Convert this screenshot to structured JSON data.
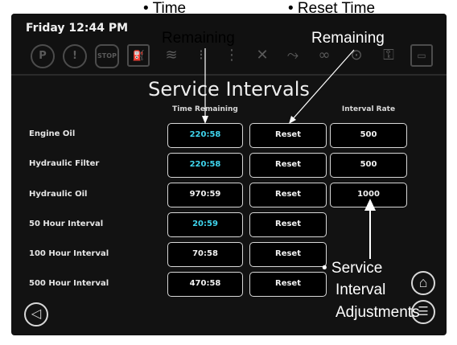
{
  "status_bar": {
    "clock": "Friday 12:44 PM",
    "icons": [
      {
        "name": "parking-brake-icon",
        "glyph": "P"
      },
      {
        "name": "warning-icon",
        "glyph": "!"
      },
      {
        "name": "stop-icon",
        "glyph": "STOP"
      },
      {
        "name": "fuel-filter-icon",
        "glyph": "⛽"
      },
      {
        "name": "coolant-temp-icon",
        "glyph": "≋"
      },
      {
        "name": "hydraulic-warning-icon",
        "glyph": "⁝"
      },
      {
        "name": "battery-icon",
        "glyph": "⋮"
      },
      {
        "name": "engine-fault-icon",
        "glyph": "✕"
      },
      {
        "name": "hydraulic-oil-icon",
        "glyph": "⤳"
      },
      {
        "name": "oil-pressure-icon",
        "glyph": "∞"
      },
      {
        "name": "engine-temp-icon",
        "glyph": "⊙"
      },
      {
        "name": "transmission-icon",
        "glyph": "⚿"
      },
      {
        "name": "display-icon",
        "glyph": "▭"
      }
    ]
  },
  "page": {
    "title": "Service Intervals",
    "columns": {
      "time_remaining": "Time Remaining",
      "interval_rate": "Interval Rate"
    },
    "rows": [
      {
        "label": "Engine Oil",
        "time_remaining": "220:58",
        "reset": "Reset",
        "interval_rate": "500",
        "highlight": true
      },
      {
        "label": "Hydraulic Filter",
        "time_remaining": "220:58",
        "reset": "Reset",
        "interval_rate": "500",
        "highlight": true
      },
      {
        "label": "Hydraulic Oil",
        "time_remaining": "970:59",
        "reset": "Reset",
        "interval_rate": "1000",
        "highlight": false
      },
      {
        "label": "50 Hour Interval",
        "time_remaining": "20:59",
        "reset": "Reset",
        "interval_rate": "",
        "highlight": true
      },
      {
        "label": "100 Hour Interval",
        "time_remaining": "70:58",
        "reset": "Reset",
        "interval_rate": "",
        "highlight": false
      },
      {
        "label": "500 Hour Interval",
        "time_remaining": "470:58",
        "reset": "Reset",
        "interval_rate": "",
        "highlight": false
      }
    ],
    "highlight_color": "#3fd5ee"
  },
  "nav": {
    "back_glyph": "◁",
    "home_glyph": "⌂",
    "menu_glyph": "☰"
  },
  "annotations": {
    "time_remaining": [
      "• Time",
      "Remaining"
    ],
    "reset_time_remaining": [
      "• Reset Time",
      "Remaining"
    ],
    "service_interval": [
      "• Service",
      "Interval",
      "Adjustments"
    ]
  }
}
